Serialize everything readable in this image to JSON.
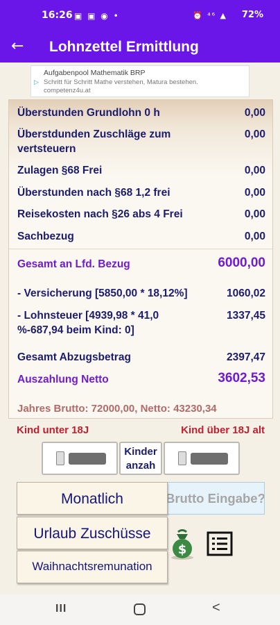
{
  "status_bar": {
    "time": "16:26",
    "notification_icons": "▣ ▣ ◉ •",
    "system_icons": "⏰ ⁴⁶ ▲",
    "battery": "72%"
  },
  "app_bar": {
    "back_icon": "←",
    "title": "Lohnzettel Ermittlung"
  },
  "ad": {
    "title": "Aufgabenpool Mathematik BRP",
    "text": "Schritt für Schritt Mathe verstehen, Matura bestehen.",
    "url": "competenz4u.at"
  },
  "rows": [
    {
      "label": "Überstunden Grundlohn 0 h",
      "value": "0,00"
    },
    {
      "label": "Überstdunden Zuschläge zum vertsteuern",
      "value": "0,00"
    },
    {
      "label": "Zulagen §68 Frei",
      "value": "0,00"
    },
    {
      "label": "Überstunden nach §68 1,2 frei",
      "value": "0,00"
    },
    {
      "label": "Reisekosten nach §26 abs 4 Frei",
      "value": "0,00"
    },
    {
      "label": "Sachbezug",
      "value": "0,00"
    }
  ],
  "gesamt_bezug": {
    "label": "Gesamt an Lfd. Bezug",
    "value": "6000,00"
  },
  "versicherung": {
    "label": "- Versicherung [5850,00 * 18,12%]",
    "value": "1060,02"
  },
  "lohnsteuer": {
    "label": "- Lohnsteuer [4939,98 * 41,0 %-687,94 beim Kind: 0]",
    "value": "1337,45"
  },
  "abzug": {
    "label": "Gesamt Abzugsbetrag",
    "value": "2397,47"
  },
  "netto": {
    "label": "Auszahlung Netto",
    "value": "3602,53"
  },
  "jahres": "Jahres Brutto: 72000,00, Netto: 43230,34",
  "kinder": {
    "unter_label": "Kind unter 18J",
    "ueber_label": "Kind über 18J alt",
    "anzahl_line1": "Kinder",
    "anzahl_line2": "anzah",
    "unter_on": false,
    "ueber_on": false
  },
  "buttons": {
    "monatlich": "Monatlich",
    "urlaub": "Urlaub Zuschüsse",
    "weihnacht": "Waihnachtsremunation",
    "brutto": "Brutto Eingabe?"
  },
  "icons": {
    "money": "money-bag-icon",
    "list": "list-icon"
  },
  "colors": {
    "appbar": "#6a16e8",
    "label_text": "#1c1c6e",
    "total_text": "#7019d6",
    "kind_text": "#c01f2e",
    "jahres_text": "#b26a6a"
  },
  "nav": {
    "recent": "III",
    "back": "<"
  }
}
